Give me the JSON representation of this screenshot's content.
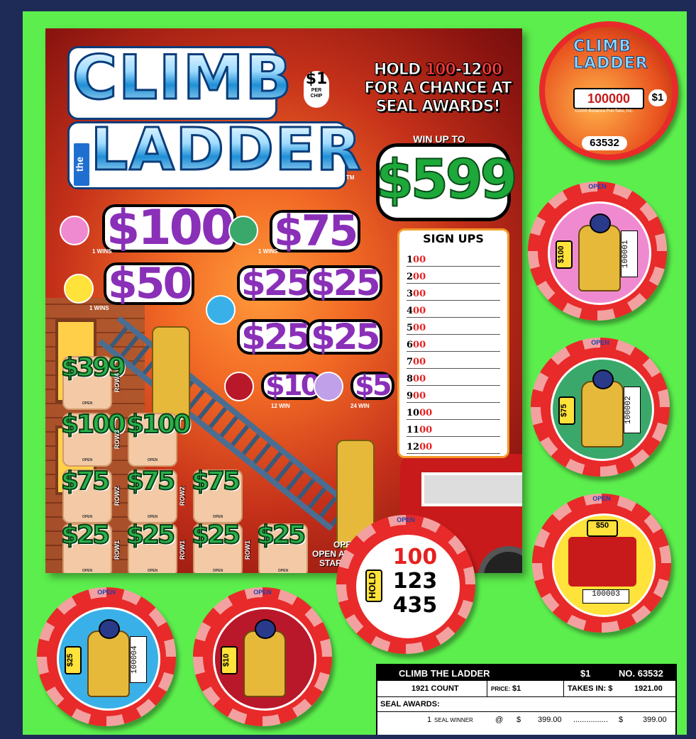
{
  "logo": {
    "line1": "CLIMB",
    "the": "the",
    "line2": "LADDER",
    "tm": "TM"
  },
  "per_chip": {
    "price": "$1",
    "label1": "PER",
    "label2": "CHIP"
  },
  "hold_banner": {
    "line1_a": "HOLD ",
    "line1_b": "100",
    "line1_c": "-12",
    "line1_d": "00",
    "line2": "FOR A CHANCE AT",
    "line3": "SEAL AWARDS!"
  },
  "win_up_to": {
    "label": "WIN UP TO",
    "amount": "$599"
  },
  "signups": {
    "title": "SIGN UPS",
    "rows": [
      {
        "a": "1",
        "b": "00"
      },
      {
        "a": "2",
        "b": "00"
      },
      {
        "a": "3",
        "b": "00"
      },
      {
        "a": "4",
        "b": "00"
      },
      {
        "a": "5",
        "b": "00"
      },
      {
        "a": "6",
        "b": "00"
      },
      {
        "a": "7",
        "b": "00"
      },
      {
        "a": "8",
        "b": "00"
      },
      {
        "a": "9",
        "b": "00"
      },
      {
        "a": "10",
        "b": "00"
      },
      {
        "a": "11",
        "b": "00"
      },
      {
        "a": "12",
        "b": "00"
      }
    ]
  },
  "prizes": {
    "p100": "$100",
    "p100_wins": "1 WINS",
    "p75": "$75",
    "p75_wins": "1 WINS",
    "p50": "$50",
    "p50_wins": "1 WINS",
    "p25a": "$25",
    "p25b": "$25",
    "p25c": "$25",
    "p25d": "$25",
    "p10": "$10",
    "p10_wins": "12 WIN",
    "p5": "$5",
    "p5_wins": "24 WIN"
  },
  "tabs": {
    "open_label": "OPEN",
    "row4": [
      "$399"
    ],
    "row3": [
      "$100",
      "$100"
    ],
    "row2": [
      "$75",
      "$75",
      "$75"
    ],
    "row1": [
      "$25",
      "$25",
      "$25",
      "$25"
    ],
    "row_labels": {
      "row4": "ROW4",
      "row3": "ROW3",
      "row2": "ROW2",
      "row1": "ROW1"
    }
  },
  "open_start": {
    "line1": "OPEN",
    "line2": "OPEN AT",
    "line3": "START"
  },
  "logo_chip": {
    "title1": "CLIMB",
    "title2": "LADDER",
    "tm": "TM",
    "number": "100000",
    "price": "$1",
    "copyright": "©2005 Bonanza Pull-Tabs, Inc.",
    "serial": "63532"
  },
  "chips": [
    {
      "value": "$100",
      "serial": "100001",
      "open": "OPEN",
      "color": "#f08ad0"
    },
    {
      "value": "$75",
      "serial": "100002",
      "open": "OPEN",
      "color": "#3aa86a"
    },
    {
      "value": "$50",
      "serial": "100003",
      "open": "OPEN",
      "color": "#ffe23a"
    },
    {
      "value": "$25",
      "serial": "100004",
      "open": "OPEN",
      "color": "#3ab0e8"
    },
    {
      "value": "$10",
      "serial": "",
      "open": "OPEN",
      "color": "#b8182a"
    }
  ],
  "hold_chip": {
    "tag": "HOLD",
    "n1": "100",
    "n2": "123",
    "n3": "435",
    "open": "OPEN"
  },
  "flare": {
    "title": "CLIMB THE LADDER",
    "price": "$1",
    "no": "NO. 63532",
    "count": "1921 COUNT",
    "price_label": "PRICE:",
    "price_value": "$1",
    "takes_in": "TAKES IN: $",
    "takes_in_value": "1921.00",
    "seal_awards": "SEAL AWARDS:",
    "row1": {
      "qty": "1",
      "label": "SEAL WINNER",
      "at": "@",
      "dollar": "$",
      "amount": "399.00",
      "dots": "................",
      "dollar2": "$",
      "total": "399.00"
    }
  }
}
